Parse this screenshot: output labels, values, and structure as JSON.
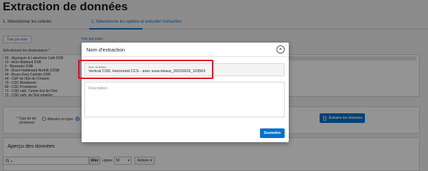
{
  "page": {
    "title": "Extraction de données"
  },
  "tabs": [
    {
      "label": "1. Sélectionner les cellules"
    },
    {
      "label": "2. Sélectionner les options et exécuter l'extraction"
    }
  ],
  "sort": {
    "by_name": "Trier par nom",
    "by_index": "Trier par index"
  },
  "recipients": {
    "label": "Sélectionner les destinataires",
    "required_mark": "*",
    "items": [
      "60 - Algonquin & Lakeshore Cath DSB",
      "10 - Avon Maitland DSB",
      "9 - Bluewater DSB",
      "54 - Brant Haldimand Norfolk CDSB",
      "40 - Bruce-Grey Catholic DSB",
      "64 - CEP de l'Est de l'Ontario",
      "70 - CSC MonAvenir",
      "69 - CSC Providence",
      "71 - CSD cath. Centre-Est de l'Ont.",
      "72 - CSD cath. de l'Est ontarien"
    ]
  },
  "deployment": {
    "label_line1": "Type de dé-",
    "label_line2": "ploiement",
    "required_mark": "*",
    "option_online": "Attendre en ligne"
  },
  "extract_button": "Extraire les données",
  "preview": {
    "title": "Aperçu des données",
    "go": "Aller",
    "rows_label": "Lignes",
    "rows_value": "50",
    "actions": "Actions"
  },
  "dialog": {
    "title": "Nom d'extraction",
    "close_glyph": "×",
    "file_label": "Nom de fichier",
    "file_value": "Vertical CSD, Horizontal CCS - avec sous-totaux_20210629_103503",
    "description_placeholder": "Description",
    "submit": "Soumettre"
  },
  "colors": {
    "accent": "#0572ce",
    "highlight": "#e8001c"
  }
}
